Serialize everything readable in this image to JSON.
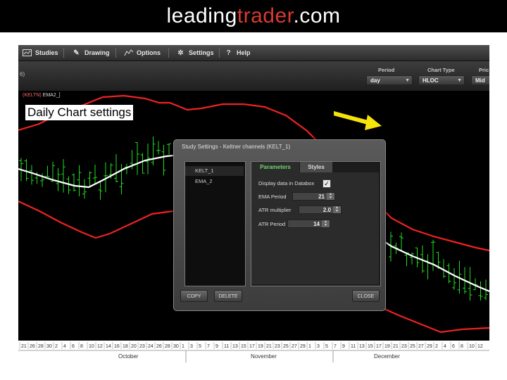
{
  "banner": {
    "part1": "leading",
    "part2": "trader",
    "part3": ".com"
  },
  "menu": [
    {
      "label": "Studies",
      "icon": "studies-icon"
    },
    {
      "label": "Drawing",
      "icon": "pencil-icon"
    },
    {
      "label": "Options",
      "icon": "options-icon"
    },
    {
      "label": "Settings",
      "icon": "gear-icon"
    },
    {
      "label": "Help",
      "icon": "help-icon"
    }
  ],
  "toolbar": {
    "left_fragment": "6)",
    "period_label": "Period",
    "period_value": "day",
    "chart_type_label": "Chart Type",
    "chart_type_value": "HLOC",
    "price_label": "Pric",
    "price_value": "Mid"
  },
  "chart": {
    "study_tag_red": "(KELTN)",
    "study_tag_white": "EMA2_]",
    "annotation": "Daily Chart settings"
  },
  "dialog": {
    "title": "Study Settings - Keltner channels (KELT_1)",
    "studies": [
      "KELT_1",
      "EMA_2"
    ],
    "tabs": {
      "active": "Parameters",
      "inactive": "Styles"
    },
    "params": {
      "display_label": "Display data in Databox",
      "display_checked": "✓",
      "ema_label": "EMA Period",
      "ema_value": "21",
      "atr_mult_label": "ATR multiplier",
      "atr_mult_value": "2.0",
      "atr_period_label": "ATR Period",
      "atr_period_value": "14"
    },
    "buttons": {
      "copy": "COPY",
      "delete": "DELETE",
      "close": "CLOSE"
    }
  },
  "axis": {
    "days": [
      "21",
      "26",
      "28",
      "30",
      "2",
      "4",
      "6",
      "8",
      "10",
      "12",
      "14",
      "16",
      "18",
      "20",
      "23",
      "24",
      "26",
      "28",
      "30",
      "1",
      "3",
      "5",
      "7",
      "9",
      "11",
      "13",
      "15",
      "17",
      "19",
      "21",
      "23",
      "25",
      "27",
      "29",
      "1",
      "3",
      "5",
      "7",
      "9",
      "11",
      "13",
      "15",
      "17",
      "19",
      "21",
      "23",
      "25",
      "27",
      "29",
      "2",
      "4",
      "6",
      "8",
      "10",
      "12"
    ],
    "months": [
      "October",
      "November",
      "December"
    ]
  },
  "colors": {
    "accent": "#d63a33",
    "bars": "#22dd22",
    "upper_band": "#ee2222",
    "ema": "#ffffff",
    "arrow": "#f5e30a",
    "active_tab": "#6fd86f"
  }
}
